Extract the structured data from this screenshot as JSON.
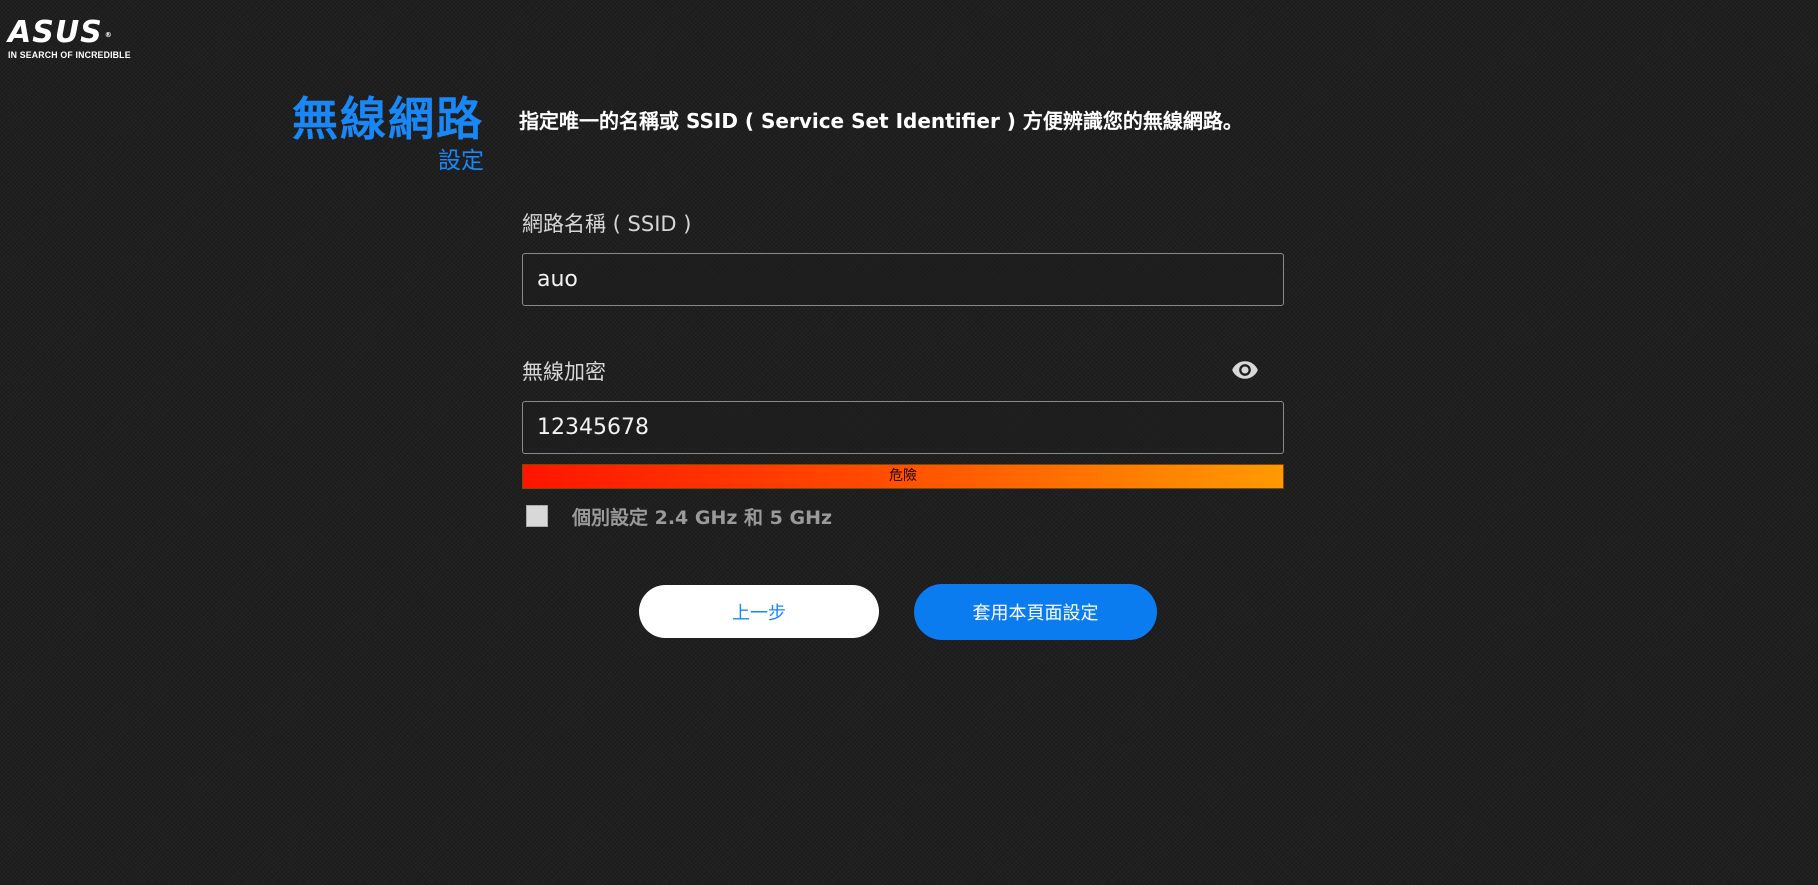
{
  "logo": {
    "word": "ASUS",
    "registered": "®",
    "tagline": "IN SEARCH OF INCREDIBLE"
  },
  "header": {
    "title": "無線網路",
    "subtitle": "設定"
  },
  "description": "指定唯一的名稱或 SSID ( Service Set Identifier ) 方便辨識您的無線網路。",
  "form": {
    "ssid_label": "網路名稱 ( SSID )",
    "ssid_value": "auo",
    "password_label": "無線加密",
    "password_value": "12345678",
    "strength_label": "危險",
    "strength_level": 1.0,
    "separate_band_label": "個別設定 2.4 GHz 和 5 GHz",
    "separate_band_checked": false
  },
  "buttons": {
    "back_label": "上一步",
    "apply_label": "套用本頁面設定"
  },
  "colors": {
    "accent": "#1a87f6",
    "primary_button": "#0b7cf0",
    "background": "#1f1f1f",
    "strength_start": "#ff1500",
    "strength_end": "#ff9a00"
  },
  "icons": {
    "password_toggle": "eye-icon"
  }
}
